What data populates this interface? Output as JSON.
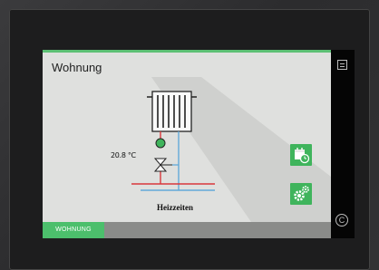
{
  "screen": {
    "title": "Wohnung",
    "temperature": "20.8 °C",
    "heating_times_label": "Heizzeiten",
    "footer_tab": "WOHNUNG"
  },
  "sidebar": {
    "menu_icon": "menu-list-icon",
    "bottom_icon": "copyright-icon",
    "bottom_glyph": "C"
  },
  "buttons": {
    "schedule_icon": "calendar-clock-icon",
    "settings_icon": "gears-icon"
  },
  "colors": {
    "accent_green": "#3fb45c",
    "supply_red": "#d9373b",
    "return_blue": "#62a9d8"
  }
}
